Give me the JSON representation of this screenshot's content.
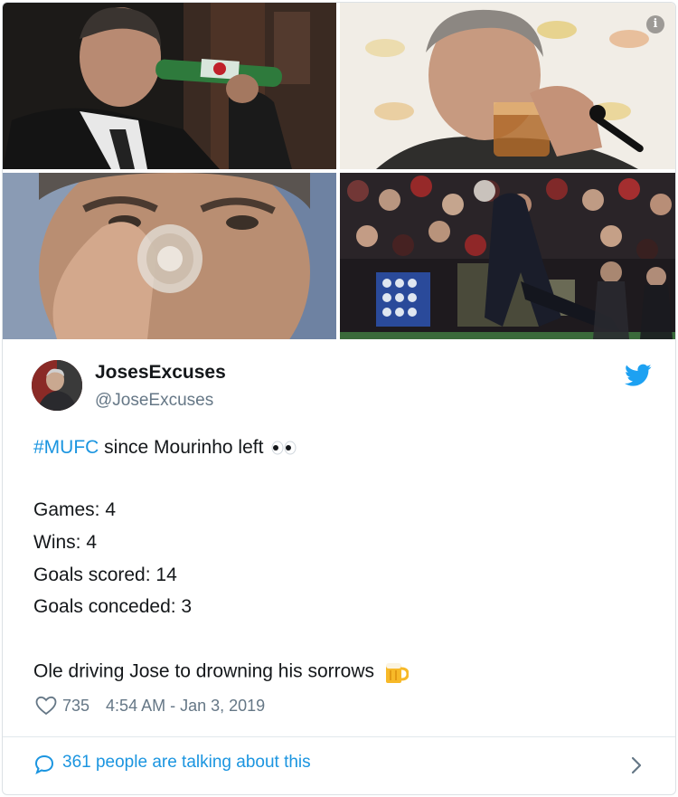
{
  "tweet": {
    "display_name": "JosesExcuses",
    "handle": "@JoseExcuses",
    "hashtag": "#MUFC",
    "line1_rest": " since Mourinho left",
    "stats": [
      "Games: 4",
      "Wins: 4",
      "Goals scored: 14",
      "Goals conceded: 3"
    ],
    "closing": "Ole driving Jose to drowning his sorrows",
    "likes": "735",
    "timestamp": "4:54 AM - Jan 3, 2019",
    "talking": "361 people are talking about this"
  },
  "icons": {
    "info": "info-icon",
    "bird": "twitter-bird-icon",
    "heart": "heart-icon",
    "bubble": "speech-bubble-icon",
    "chevron": "chevron-right-icon",
    "eyes": "eyes-emoji",
    "beer": "beer-mug-emoji"
  },
  "colors": {
    "link": "#1b95e0",
    "muted": "#657786",
    "text": "#14171a",
    "border": "#e1e8ed"
  }
}
